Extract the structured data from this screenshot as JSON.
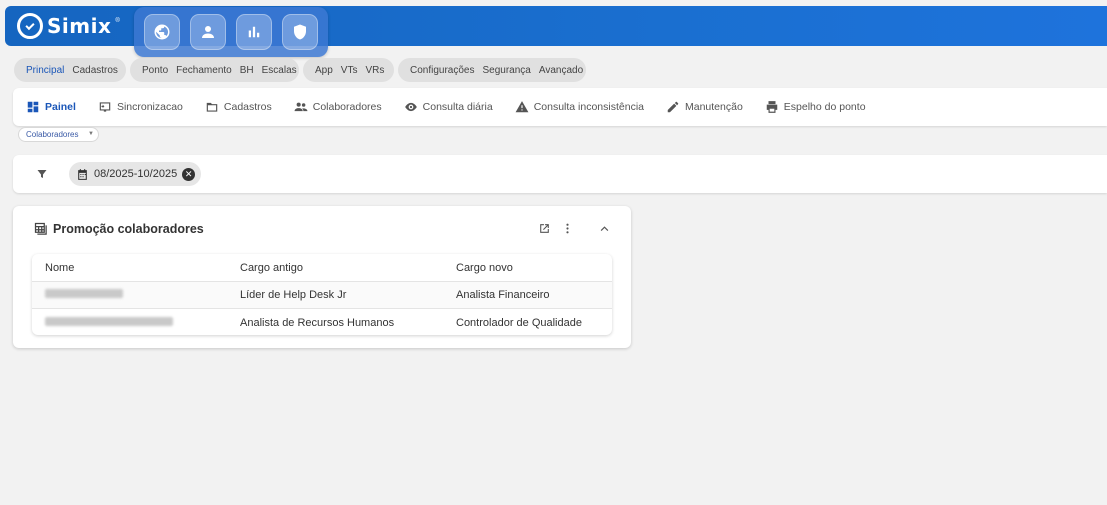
{
  "app": {
    "name": "Simix",
    "reg_mark": "®"
  },
  "quickbar": [
    {
      "icon": "globe-icon"
    },
    {
      "icon": "user-icon"
    },
    {
      "icon": "bar-chart-icon"
    },
    {
      "icon": "shield-icon"
    }
  ],
  "groups": [
    {
      "items": [
        "Principal",
        "Cadastros"
      ],
      "active": "Principal"
    },
    {
      "items": [
        "Ponto",
        "Fechamento",
        "BH",
        "Escalas"
      ]
    },
    {
      "items": [
        "App",
        "VTs",
        "VRs"
      ]
    },
    {
      "items": [
        "Configurações",
        "Segurança",
        "Avançado"
      ]
    }
  ],
  "nav": [
    {
      "label": "Painel",
      "icon": "dashboard-icon",
      "active": true
    },
    {
      "label": "Sincronizacao",
      "icon": "sync-icon"
    },
    {
      "label": "Cadastros",
      "icon": "folder-icon"
    },
    {
      "label": "Colaboradores",
      "icon": "people-icon"
    },
    {
      "label": "Consulta diária",
      "icon": "eye-icon"
    },
    {
      "label": "Consulta inconsistência",
      "icon": "warning-icon"
    },
    {
      "label": "Manutenção",
      "icon": "pencil-icon"
    },
    {
      "label": "Espelho do ponto",
      "icon": "printer-icon"
    }
  ],
  "subselect": {
    "value": "Colaboradores"
  },
  "filter": {
    "chip_label": "08/2025-10/2025"
  },
  "card": {
    "title": "Promoção colaboradores",
    "columns": [
      "Nome",
      "Cargo antigo",
      "Cargo novo"
    ],
    "rows": [
      {
        "name_redacted": true,
        "cargo_antigo": "Líder de Help Desk Jr",
        "cargo_novo": "Analista Financeiro"
      },
      {
        "name_redacted": true,
        "cargo_antigo": "Analista de Recursos Humanos",
        "cargo_novo": "Controlador de Qualidade"
      }
    ]
  },
  "colors": {
    "primary": "#1565c0",
    "accent": "#1a56b8"
  }
}
